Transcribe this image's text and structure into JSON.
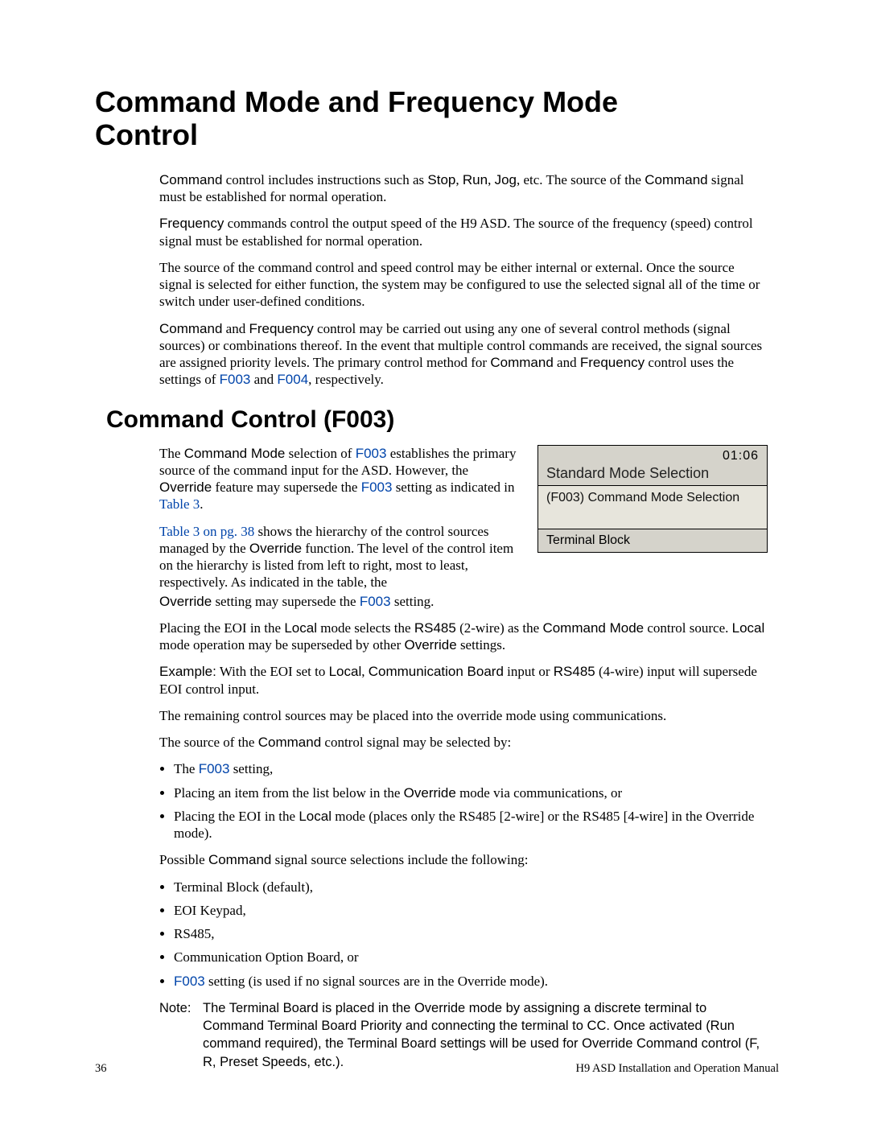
{
  "h1_line1": "Command Mode and Frequency Mode",
  "h1_line2": " Control",
  "p1_a": "Command",
  "p1_b": " control includes instructions such as ",
  "p1_c": "Stop",
  "p1_d": ", ",
  "p1_e": "Run",
  "p1_f": ", ",
  "p1_g": "Jog",
  "p1_h": ", etc. The source of the ",
  "p1_i": "Command",
  "p1_j": " signal must be established for normal operation.",
  "p2_a": "Frequency",
  "p2_b": " commands control the output speed of the H9 ASD. The source of the frequency (speed) control signal must be established for normal operation.",
  "p3": "The source of the command control and speed control may be either internal or external. Once the source signal is selected for either function, the system may be configured to use the selected signal all of the time or switch under user-defined conditions.",
  "p4_a": "Command",
  "p4_b": " and ",
  "p4_c": "Frequency",
  "p4_d": " control may be carried out using any one of several control methods (signal sources) or combinations thereof. In the event that multiple control commands are received, the signal sources are assigned priority levels. The primary control method for ",
  "p4_e": "Command",
  "p4_f": " and ",
  "p4_g": "Frequency",
  "p4_h": " control uses the settings of ",
  "p4_i": "F003",
  "p4_j": " and ",
  "p4_k": "F004",
  "p4_l": ", respectively.",
  "h2": "Command Control (F003)",
  "pc1_a": "The ",
  "pc1_b": "Command Mode",
  "pc1_c": " selection of ",
  "pc1_d": "F003",
  "pc1_e": " establishes the primary source of the command input for the ASD. However, the ",
  "pc1_f": "Override",
  "pc1_g": " feature may supersede the ",
  "pc1_h": "F003",
  "pc1_i": " setting as indicated in ",
  "pc1_j": "Table 3",
  "pc1_k": ".",
  "pc2_a": "Table 3 on pg. 38",
  "pc2_b": " shows the hierarchy of the control sources managed by the ",
  "pc2_c": "Override",
  "pc2_d": " function. The level of the control item on the hierarchy is listed from left to right, most to least, respectively. As indicated in the table, the ",
  "pc2_e": "Override",
  "pc2_f": " setting may supersede the ",
  "pc2_g": "F003",
  "pc2_h": " setting.",
  "disp_time": "01:06",
  "disp_title": "Standard Mode Selection",
  "disp_main": "(F003) Command Mode Selection",
  "disp_foot": "Terminal Block",
  "p5_a": "Placing the EOI in the ",
  "p5_b": "Local",
  "p5_c": " mode selects the ",
  "p5_d": "RS485",
  "p5_e": " (2-wire) as the ",
  "p5_f": "Command Mode",
  "p5_g": " control source. ",
  "p5_h": "Local",
  "p5_i": " mode operation may be superseded by other ",
  "p5_j": "Override",
  "p5_k": " settings.",
  "p6_a": "Example:",
  "p6_b": " With the EOI set to ",
  "p6_c": "Local",
  "p6_d": ", ",
  "p6_e": "Communication Board",
  "p6_f": " input or ",
  "p6_g": "RS485",
  "p6_h": " (4-wire) input will supersede EOI control input.",
  "p7": "The remaining control sources may be placed into the override mode using communications.",
  "p8_a": "The source of the ",
  "p8_b": "Command",
  "p8_c": " control signal may be selected by:",
  "li1_a": "The ",
  "li1_b": "F003",
  "li1_c": " setting,",
  "li2_a": "Placing an item from the list below in the ",
  "li2_b": "Override",
  "li2_c": " mode via communications, or",
  "li3_a": "Placing the EOI in the ",
  "li3_b": "Local",
  "li3_c": " mode (places only the RS485 [2-wire] or the RS485 [4-wire] in the Override mode).",
  "p9_a": "Possible ",
  "p9_b": "Command",
  "p9_c": " signal source selections include the following:",
  "sli1": "Terminal Block (default),",
  "sli2": "EOI Keypad,",
  "sli3": "RS485,",
  "sli4": "Communication Option Board, or",
  "sli5_a": "F003",
  "sli5_b": " setting (is used if no signal sources are in the Override mode).",
  "note_label": "Note:",
  "note_a": "The ",
  "note_b": "Terminal Board",
  "note_c": " is placed in the ",
  "note_d": "Override",
  "note_e": " mode by assigning a discrete terminal to ",
  "note_f": "Command Terminal Board Priority",
  "note_g": " and connecting the terminal to ",
  "note_h": "CC",
  "note_i": ". Once activated (Run command required), the ",
  "note_j": "Terminal Board",
  "note_k": " settings will be used for ",
  "note_l": "Override Command",
  "note_m": " control (F, R, Preset Speeds, etc.).",
  "footer_left": "36",
  "footer_right": "H9 ASD Installation and Operation Manual"
}
